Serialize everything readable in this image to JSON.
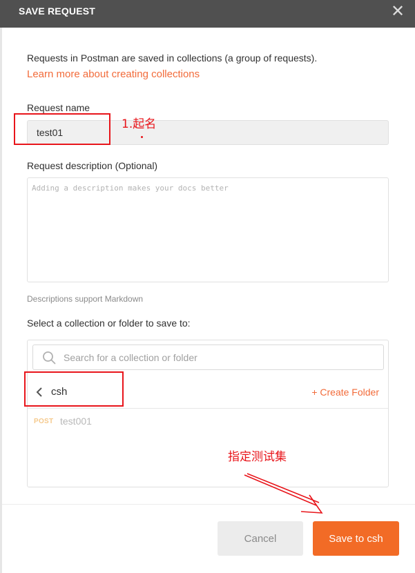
{
  "dialog": {
    "title": "SAVE REQUEST",
    "close_glyph": "✕"
  },
  "intro": {
    "text": "Requests in Postman are saved in collections (a group of requests).",
    "link": "Learn more about creating collections"
  },
  "request_name": {
    "label": "Request name",
    "value": "test01"
  },
  "description": {
    "label": "Request description (Optional)",
    "placeholder": "Adding a description makes your docs better",
    "note": "Descriptions support Markdown"
  },
  "collection": {
    "label": "Select a collection or folder to save to:",
    "search_placeholder": "Search for a collection or folder",
    "current": "csh",
    "create_folder": "+ Create Folder",
    "items": [
      {
        "method": "POST",
        "name": "test001"
      }
    ]
  },
  "footer": {
    "cancel": "Cancel",
    "save": "Save to csh"
  },
  "annotations": {
    "name_note": "1.起名",
    "collection_note": "指定测试集",
    "color": "#e8141a"
  },
  "colors": {
    "accent": "#f26b26",
    "header_bg": "#505050",
    "method_post": "#f5c98c"
  }
}
